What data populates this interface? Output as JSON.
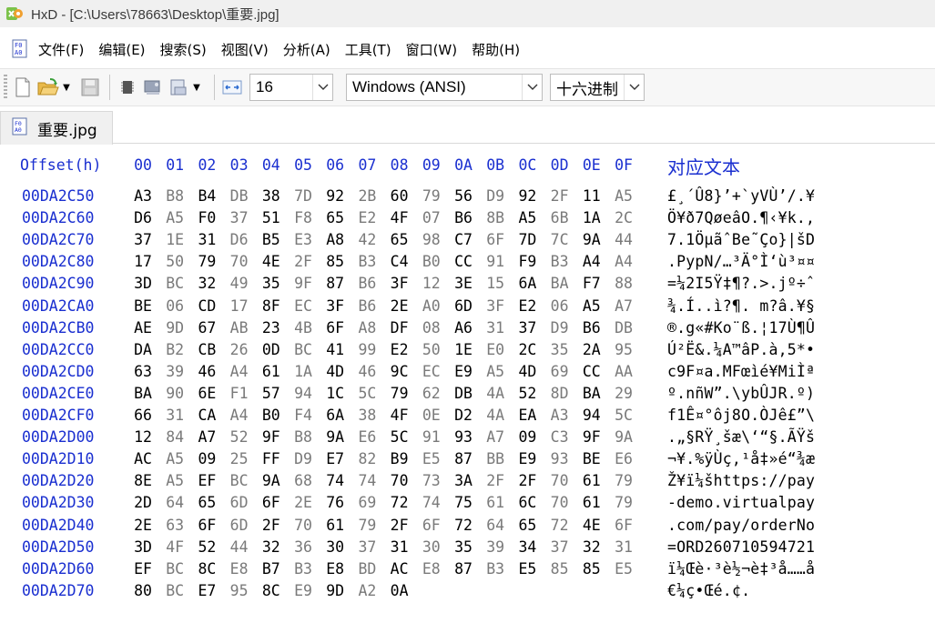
{
  "window": {
    "title": "HxD - [C:\\Users\\78663\\Desktop\\重要.jpg]"
  },
  "menu": {
    "items": [
      "文件(F)",
      "编辑(E)",
      "搜索(S)",
      "视图(V)",
      "分析(A)",
      "工具(T)",
      "窗口(W)",
      "帮助(H)"
    ]
  },
  "toolbar": {
    "bytes_per_row": "16",
    "charset": "Windows (ANSI)",
    "offset_base": "十六进制"
  },
  "tabs": [
    {
      "label": "重要.jpg",
      "icon": "hex-file-icon"
    }
  ],
  "colors": {
    "accent_blue": "#1a2fd0",
    "byte_even": "#000000",
    "byte_odd": "#7a7a7a"
  },
  "hexview": {
    "offset_header": "Offset(h)",
    "column_headers": [
      "00",
      "01",
      "02",
      "03",
      "04",
      "05",
      "06",
      "07",
      "08",
      "09",
      "0A",
      "0B",
      "0C",
      "0D",
      "0E",
      "0F"
    ],
    "text_header": "对应文本",
    "rows": [
      {
        "offset": "00DA2C50",
        "bytes": [
          "A3",
          "B8",
          "B4",
          "DB",
          "38",
          "7D",
          "92",
          "2B",
          "60",
          "79",
          "56",
          "D9",
          "92",
          "2F",
          "11",
          "A5"
        ],
        "text": "£¸´Û8}’+`yVÙ’/.¥"
      },
      {
        "offset": "00DA2C60",
        "bytes": [
          "D6",
          "A5",
          "F0",
          "37",
          "51",
          "F8",
          "65",
          "E2",
          "4F",
          "07",
          "B6",
          "8B",
          "A5",
          "6B",
          "1A",
          "2C"
        ],
        "text": "Ö¥ð7QøeâO.¶‹¥k.,"
      },
      {
        "offset": "00DA2C70",
        "bytes": [
          "37",
          "1E",
          "31",
          "D6",
          "B5",
          "E3",
          "A8",
          "42",
          "65",
          "98",
          "C7",
          "6F",
          "7D",
          "7C",
          "9A",
          "44"
        ],
        "text": "7.1ÖµãˆBe˜Ço}|šD"
      },
      {
        "offset": "00DA2C80",
        "bytes": [
          "17",
          "50",
          "79",
          "70",
          "4E",
          "2F",
          "85",
          "B3",
          "C4",
          "B0",
          "CC",
          "91",
          "F9",
          "B3",
          "A4",
          "A4"
        ],
        "text": ".PypN/…³Ä°Ì‘ù³¤¤"
      },
      {
        "offset": "00DA2C90",
        "bytes": [
          "3D",
          "BC",
          "32",
          "49",
          "35",
          "9F",
          "87",
          "B6",
          "3F",
          "12",
          "3E",
          "15",
          "6A",
          "BA",
          "F7",
          "88"
        ],
        "text": "=¼2I5Ÿ‡¶?.>.jº÷ˆ"
      },
      {
        "offset": "00DA2CA0",
        "bytes": [
          "BE",
          "06",
          "CD",
          "17",
          "8F",
          "EC",
          "3F",
          "B6",
          "2E",
          "A0",
          "6D",
          "3F",
          "E2",
          "06",
          "A5",
          "A7"
        ],
        "text": "¾.Í..ì?¶. m?â.¥§"
      },
      {
        "offset": "00DA2CB0",
        "bytes": [
          "AE",
          "9D",
          "67",
          "AB",
          "23",
          "4B",
          "6F",
          "A8",
          "DF",
          "08",
          "A6",
          "31",
          "37",
          "D9",
          "B6",
          "DB"
        ],
        "text": "®.g«#Ko¨ß.¦17Ù¶Û"
      },
      {
        "offset": "00DA2CC0",
        "bytes": [
          "DA",
          "B2",
          "CB",
          "26",
          "0D",
          "BC",
          "41",
          "99",
          "E2",
          "50",
          "1E",
          "E0",
          "2C",
          "35",
          "2A",
          "95"
        ],
        "text": "Ú²Ë&.¼A™âP.à,5*•"
      },
      {
        "offset": "00DA2CD0",
        "bytes": [
          "63",
          "39",
          "46",
          "A4",
          "61",
          "1A",
          "4D",
          "46",
          "9C",
          "EC",
          "E9",
          "A5",
          "4D",
          "69",
          "CC",
          "AA"
        ],
        "text": "c9F¤a.MFœìé¥MiÌª"
      },
      {
        "offset": "00DA2CE0",
        "bytes": [
          "BA",
          "90",
          "6E",
          "F1",
          "57",
          "94",
          "1C",
          "5C",
          "79",
          "62",
          "DB",
          "4A",
          "52",
          "8D",
          "BA",
          "29"
        ],
        "text": "º.nñW”.\\ybÛJR.º)"
      },
      {
        "offset": "00DA2CF0",
        "bytes": [
          "66",
          "31",
          "CA",
          "A4",
          "B0",
          "F4",
          "6A",
          "38",
          "4F",
          "0E",
          "D2",
          "4A",
          "EA",
          "A3",
          "94",
          "5C"
        ],
        "text": "f1Ê¤°ôj8O.ÒJê£”\\"
      },
      {
        "offset": "00DA2D00",
        "bytes": [
          "12",
          "84",
          "A7",
          "52",
          "9F",
          "B8",
          "9A",
          "E6",
          "5C",
          "91",
          "93",
          "A7",
          "09",
          "C3",
          "9F",
          "9A"
        ],
        "text": ".„§RŸ¸šæ\\‘“§.ÃŸš"
      },
      {
        "offset": "00DA2D10",
        "bytes": [
          "AC",
          "A5",
          "09",
          "25",
          "FF",
          "D9",
          "E7",
          "82",
          "B9",
          "E5",
          "87",
          "BB",
          "E9",
          "93",
          "BE",
          "E6"
        ],
        "text": "¬¥.%ÿÙç‚¹å‡»é“¾æ"
      },
      {
        "offset": "00DA2D20",
        "bytes": [
          "8E",
          "A5",
          "EF",
          "BC",
          "9A",
          "68",
          "74",
          "74",
          "70",
          "73",
          "3A",
          "2F",
          "2F",
          "70",
          "61",
          "79"
        ],
        "text": "Ž¥ï¼šhttps://pay"
      },
      {
        "offset": "00DA2D30",
        "bytes": [
          "2D",
          "64",
          "65",
          "6D",
          "6F",
          "2E",
          "76",
          "69",
          "72",
          "74",
          "75",
          "61",
          "6C",
          "70",
          "61",
          "79"
        ],
        "text": "-demo.virtualpay"
      },
      {
        "offset": "00DA2D40",
        "bytes": [
          "2E",
          "63",
          "6F",
          "6D",
          "2F",
          "70",
          "61",
          "79",
          "2F",
          "6F",
          "72",
          "64",
          "65",
          "72",
          "4E",
          "6F"
        ],
        "text": ".com/pay/orderNo"
      },
      {
        "offset": "00DA2D50",
        "bytes": [
          "3D",
          "4F",
          "52",
          "44",
          "32",
          "36",
          "30",
          "37",
          "31",
          "30",
          "35",
          "39",
          "34",
          "37",
          "32",
          "31"
        ],
        "text": "=ORD260710594721"
      },
      {
        "offset": "00DA2D60",
        "bytes": [
          "EF",
          "BC",
          "8C",
          "E8",
          "B7",
          "B3",
          "E8",
          "BD",
          "AC",
          "E8",
          "87",
          "B3",
          "E5",
          "85",
          "85",
          "E5"
        ],
        "text": "ï¼Œè·³è½¬è‡³å……å"
      },
      {
        "offset": "00DA2D70",
        "bytes": [
          "80",
          "BC",
          "E7",
          "95",
          "8C",
          "E9",
          "9D",
          "A2",
          "0A"
        ],
        "text": "€¼ç•Œé.¢."
      }
    ]
  }
}
